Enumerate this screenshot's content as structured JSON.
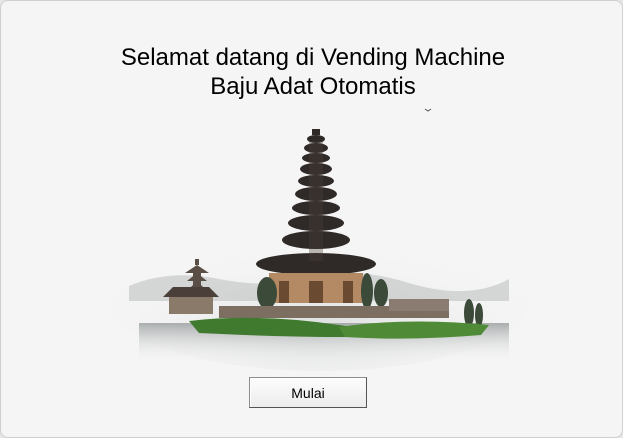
{
  "welcome": {
    "line1": "Selamat datang di Vending Machine",
    "line2": "Baju Adat Otomatis"
  },
  "image": {
    "icon": "bali-temple-pura-ulun-danu-image"
  },
  "start_button": {
    "label": "Mulai"
  },
  "colors": {
    "background": "#f5f5f5",
    "text": "#000000",
    "button_face": "#ececec",
    "button_border": "#8c8c8c"
  }
}
